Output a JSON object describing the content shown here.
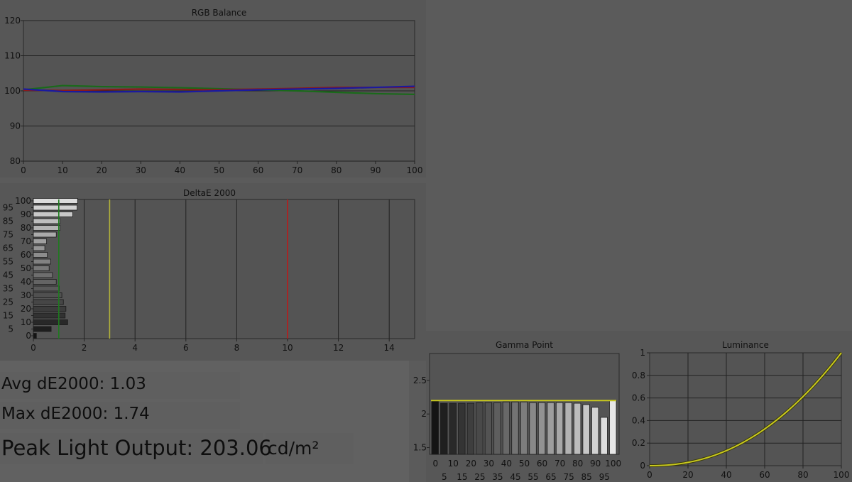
{
  "stats": {
    "avg_label": "Avg dE2000: 1.03",
    "max_label": "Max dE2000: 1.74",
    "peak_label": "Peak Light Output: 203.06",
    "peak_unit": "cd/m²"
  },
  "chart_data": [
    {
      "type": "line",
      "title": "RGB Balance",
      "xlim": [
        0,
        100
      ],
      "ylim": [
        80,
        120
      ],
      "xticks": [
        "0",
        "10",
        "20",
        "30",
        "40",
        "50",
        "60",
        "70",
        "80",
        "90",
        "100"
      ],
      "yticks": [
        "80",
        "90",
        "100",
        "110",
        "120"
      ],
      "grid": true,
      "series": [
        {
          "color": "#1a6a1a",
          "x": [
            0,
            10,
            20,
            30,
            40,
            50,
            60,
            70,
            80,
            90,
            100
          ],
          "y": [
            100.3,
            101.5,
            101.2,
            101.1,
            100.9,
            100.6,
            100.3,
            100,
            99.6,
            99.2,
            99
          ]
        },
        {
          "color": "#8a1a1a",
          "x": [
            0,
            10,
            20,
            30,
            40,
            50,
            60,
            70,
            80,
            90,
            100
          ],
          "y": [
            100.2,
            100.1,
            100.3,
            100.5,
            100.4,
            100.3,
            100.5,
            100.7,
            101,
            101,
            101
          ]
        },
        {
          "color": "#1a1aa0",
          "x": [
            0,
            10,
            20,
            30,
            40,
            50,
            60,
            70,
            80,
            90,
            100
          ],
          "y": [
            100.5,
            99.8,
            99.7,
            99.8,
            99.7,
            100,
            100.3,
            100.5,
            100.7,
            101,
            101.3
          ]
        }
      ]
    },
    {
      "type": "bar",
      "orientation": "horizontal",
      "title": "DeltaE 2000",
      "xlim": [
        0,
        15
      ],
      "xticks": [
        "0",
        "2",
        "4",
        "6",
        "8",
        "10",
        "12",
        "14"
      ],
      "categories": [
        "0",
        "5",
        "10",
        "15",
        "20",
        "25",
        "30",
        "35",
        "40",
        "45",
        "50",
        "55",
        "60",
        "65",
        "70",
        "75",
        "80",
        "85",
        "90",
        "95",
        "100"
      ],
      "values": [
        0.12,
        0.7,
        1.35,
        1.25,
        1.28,
        1.18,
        1.12,
        1.02,
        0.9,
        0.75,
        0.62,
        0.68,
        0.55,
        0.45,
        0.52,
        0.9,
        1.05,
        1.05,
        1.55,
        1.72,
        1.74
      ],
      "reference_lines": [
        {
          "x": 1,
          "color": "#1e7a1e"
        },
        {
          "x": 3,
          "color": "#b2b23a"
        },
        {
          "x": 10,
          "color": "#b81c1c"
        }
      ],
      "grid": true
    },
    {
      "type": "bar",
      "title": "Gamma Point",
      "categories": [
        "0",
        "5",
        "10",
        "15",
        "20",
        "25",
        "30",
        "35",
        "40",
        "45",
        "50",
        "55",
        "60",
        "65",
        "70",
        "75",
        "80",
        "85",
        "90",
        "95",
        "100"
      ],
      "values": [
        2.2,
        2.16,
        2.16,
        2.16,
        2.16,
        2.17,
        2.17,
        2.17,
        2.18,
        2.18,
        2.18,
        2.17,
        2.17,
        2.17,
        2.17,
        2.17,
        2.16,
        2.14,
        2.1,
        1.95,
        2.2
      ],
      "target": 2.2,
      "target_color": "#c8c81e",
      "ylim": [
        1.4,
        2.9
      ],
      "yticks": [
        "1.5",
        "2",
        "2.5"
      ],
      "xticks_top": [
        "0",
        "10",
        "20",
        "30",
        "40",
        "50",
        "60",
        "70",
        "80",
        "90",
        "100"
      ],
      "xticks_bottom": [
        "5",
        "15",
        "25",
        "35",
        "45",
        "55",
        "65",
        "75",
        "85",
        "95"
      ]
    },
    {
      "type": "line",
      "title": "Luminance",
      "xlim": [
        0,
        100
      ],
      "ylim": [
        0,
        1
      ],
      "xticks": [
        "0",
        "20",
        "40",
        "60",
        "80",
        "100"
      ],
      "yticks": [
        "0",
        "0.2",
        "0.4",
        "0.6",
        "0.8",
        "1"
      ],
      "grid": true,
      "series": [
        {
          "color": "#c8c81e",
          "gamma": 2.2
        }
      ]
    }
  ]
}
